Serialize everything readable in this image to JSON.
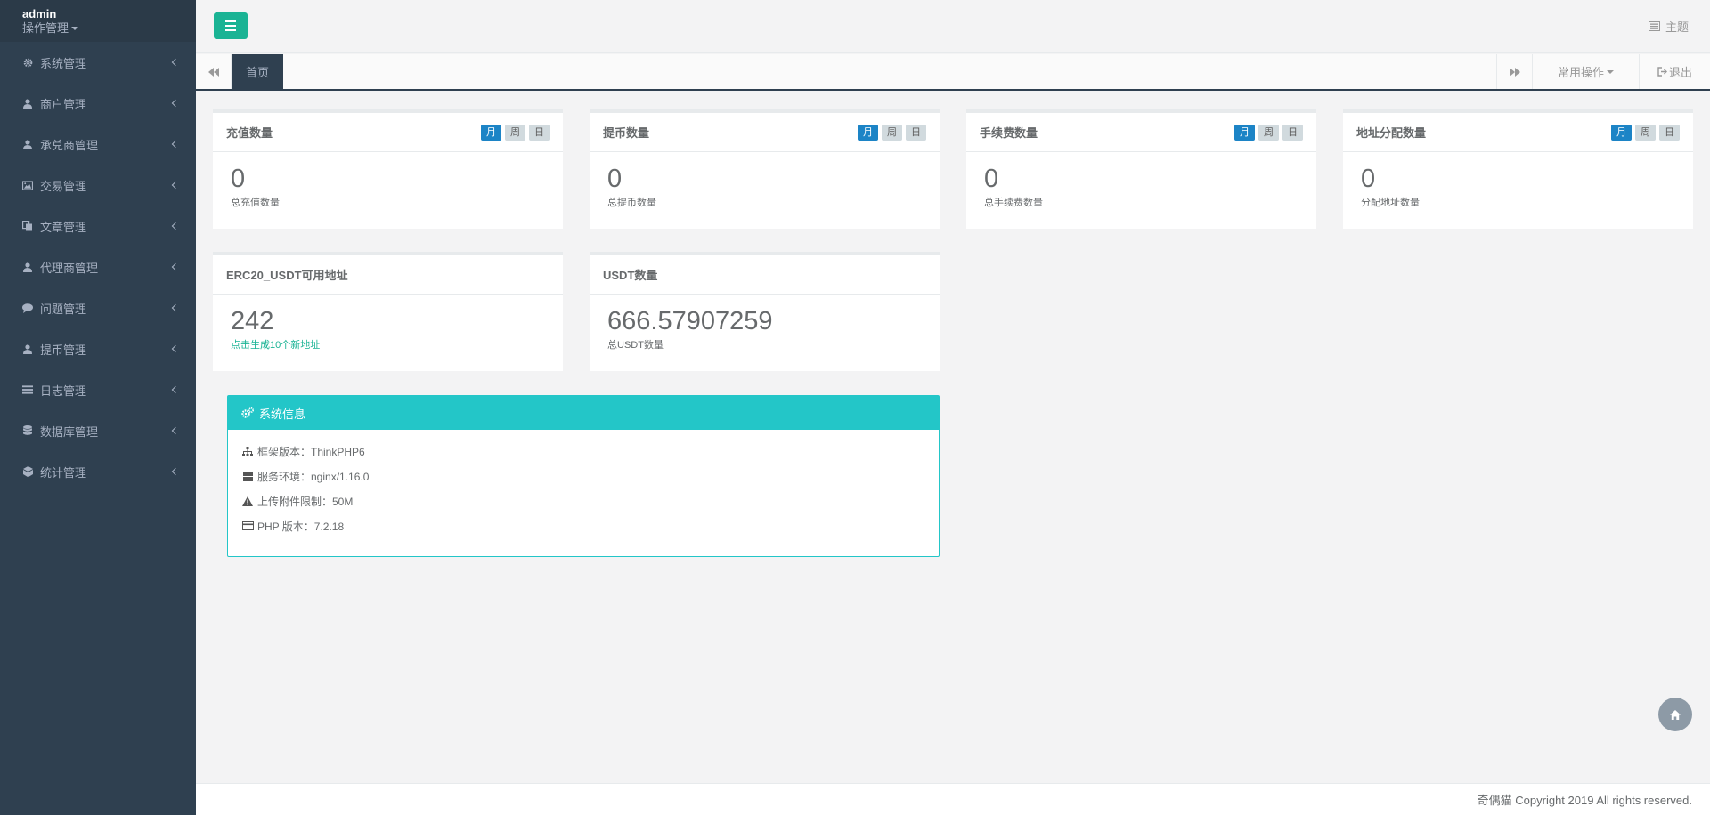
{
  "profile": {
    "name": "admin",
    "role": "操作管理"
  },
  "sidebar": {
    "items": [
      {
        "label": "系统管理",
        "icon": "gear-icon"
      },
      {
        "label": "商户管理",
        "icon": "user-icon"
      },
      {
        "label": "承兑商管理",
        "icon": "user-icon"
      },
      {
        "label": "交易管理",
        "icon": "image-icon"
      },
      {
        "label": "文章管理",
        "icon": "copy-icon"
      },
      {
        "label": "代理商管理",
        "icon": "user-icon"
      },
      {
        "label": "问题管理",
        "icon": "comment-icon"
      },
      {
        "label": "提币管理",
        "icon": "user-icon"
      },
      {
        "label": "日志管理",
        "icon": "list-icon"
      },
      {
        "label": "数据库管理",
        "icon": "database-icon"
      },
      {
        "label": "统计管理",
        "icon": "cube-icon"
      }
    ]
  },
  "topbar": {
    "theme_label": "主题"
  },
  "tabs": {
    "active": "首页",
    "common_ops": "常用操作",
    "exit": "退出"
  },
  "period_buttons": [
    "月",
    "周",
    "日"
  ],
  "stats": [
    {
      "title": "充值数量",
      "value": "0",
      "label": "总充值数量"
    },
    {
      "title": "提币数量",
      "value": "0",
      "label": "总提币数量"
    },
    {
      "title": "手续费数量",
      "value": "0",
      "label": "总手续费数量"
    },
    {
      "title": "地址分配数量",
      "value": "0",
      "label": "分配地址数量"
    }
  ],
  "address_card": {
    "title": "ERC20_USDT可用地址",
    "value": "242",
    "link": "点击生成10个新地址"
  },
  "usdt_card": {
    "title": "USDT数量",
    "value": "666.57907259",
    "label": "总USDT数量"
  },
  "sysinfo": {
    "title": "系统信息",
    "rows": [
      {
        "icon": "sitemap-icon",
        "text": "框架版本：ThinkPHP6"
      },
      {
        "icon": "windows-icon",
        "text": "服务环境：nginx/1.16.0"
      },
      {
        "icon": "warning-icon",
        "text": "上传附件限制：50M"
      },
      {
        "icon": "credit-card-icon",
        "text": "PHP 版本：7.2.18"
      }
    ]
  },
  "footer": {
    "text": "奇偶猫 Copyright 2019 All rights reserved."
  },
  "colors": {
    "sidebar_bg": "#2f4050",
    "primary": "#1ab394",
    "info": "#23c6c8",
    "active_btn": "#1c84c6"
  }
}
